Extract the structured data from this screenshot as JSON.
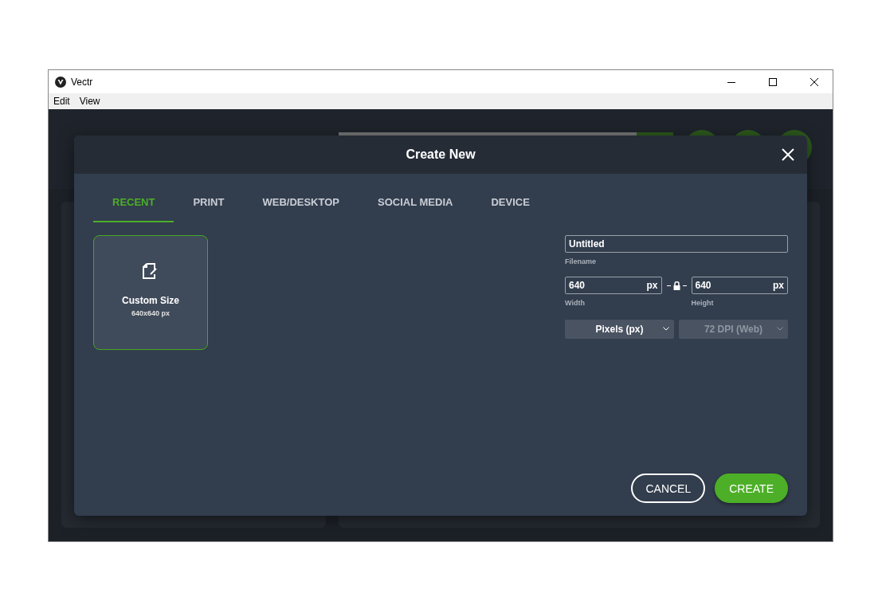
{
  "window": {
    "title": "Vectr"
  },
  "menu": [
    "Edit",
    "View"
  ],
  "toolbar": {
    "progress": {
      "level": 0.89
    }
  },
  "dialog": {
    "title": "Create New",
    "tabs": [
      {
        "label": "RECENT",
        "selected": true
      },
      {
        "label": "PRINT",
        "selected": false
      },
      {
        "label": "WEB/DESKTOP",
        "selected": false
      },
      {
        "label": "SOCIAL MEDIA",
        "selected": false
      },
      {
        "label": "DEVICE",
        "selected": false
      }
    ],
    "presets": [
      {
        "name": "Custom Size",
        "size": "640x640 px",
        "selected": true
      }
    ],
    "filename": {
      "value": "Untitled",
      "label": "Filename"
    },
    "width": {
      "value": "640",
      "unit": "px",
      "label": "Width"
    },
    "height": {
      "value": "640",
      "unit": "px",
      "label": "Height"
    },
    "aspect_locked": true,
    "unit_select": {
      "value": "Pixels (px)",
      "disabled": false
    },
    "dpi_select": {
      "value": "72 DPI (Web)",
      "disabled": true
    },
    "buttons": [
      {
        "label": "CANCEL",
        "kind": "outline"
      },
      {
        "label": "CREATE",
        "kind": "primary"
      }
    ]
  }
}
